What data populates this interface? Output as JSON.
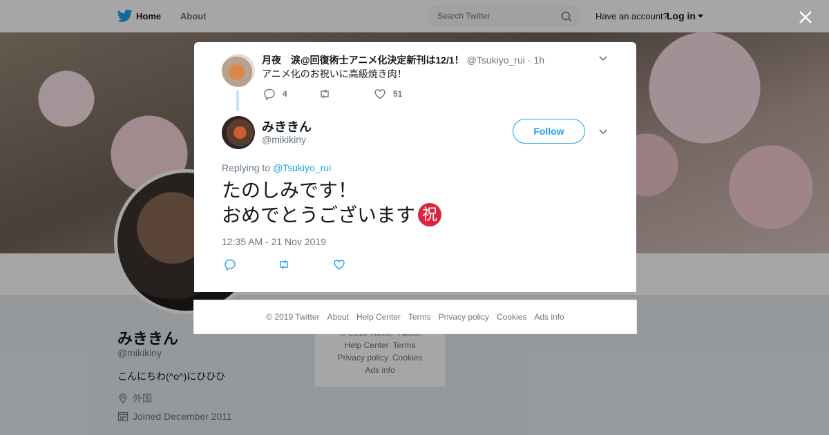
{
  "nav": {
    "home": "Home",
    "about": "About",
    "search_placeholder": "Search Twitter",
    "have_account": "Have an account?",
    "login": "Log in"
  },
  "profile": {
    "name": "みききん",
    "handle": "@mikikiny",
    "bio": "こんにちわ(^o^)にひひひ",
    "location": "外国",
    "joined": "Joined December 2011"
  },
  "bg_footer": {
    "row1": [
      "© 2019 Twitter",
      "About"
    ],
    "row2": [
      "Help Center",
      "Terms"
    ],
    "row3": [
      "Privacy policy",
      "Cookies"
    ],
    "row4": [
      "Ads info"
    ]
  },
  "parent_tweet": {
    "name": "月夜　涙@回復術士アニメ化決定新刊は12/1！",
    "handle": "@Tsukiyo_rui",
    "time": "· 1h",
    "text": "アニメ化のお祝いに高級焼き肉！",
    "replies": "4",
    "retweets": "",
    "likes": "51"
  },
  "main_tweet": {
    "name": "みききん",
    "handle": "@mikikiny",
    "follow_label": "Follow",
    "replying_prefix": "Replying to",
    "replying_to": "@Tsukiyo_rui",
    "line1": "たのしみです！",
    "line2": "おめでとうございます",
    "emoji": "祝",
    "timestamp": "12:35 AM - 21 Nov 2019"
  },
  "modal_footer": [
    "© 2019 Twitter",
    "About",
    "Help Center",
    "Terms",
    "Privacy policy",
    "Cookies",
    "Ads info"
  ],
  "colors": {
    "brand": "#1da1f2",
    "muted": "#657786",
    "text": "#14171a",
    "thread_line": "#c4e4fb",
    "emoji_bg": "#d7263d"
  },
  "icons": [
    "twitter-bird-icon",
    "search-icon",
    "caret-down-icon",
    "close-icon",
    "chevron-down-icon",
    "reply-icon",
    "retweet-icon",
    "heart-icon",
    "location-icon",
    "calendar-icon"
  ]
}
